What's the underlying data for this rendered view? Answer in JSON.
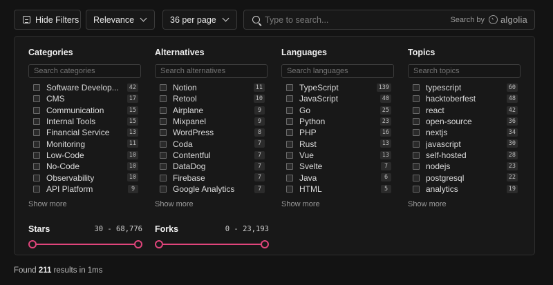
{
  "toolbar": {
    "hide_filters_label": "Hide Filters",
    "sort_value": "Relevance",
    "per_page_value": "36 per page",
    "search_placeholder": "Type to search...",
    "search_by_label": "Search by",
    "search_provider": "algolia"
  },
  "columns": [
    {
      "title": "Categories",
      "placeholder": "Search categories",
      "show_more": "Show more",
      "items": [
        {
          "label": "Software Develop...",
          "count": "42"
        },
        {
          "label": "CMS",
          "count": "17"
        },
        {
          "label": "Communication",
          "count": "15"
        },
        {
          "label": "Internal Tools",
          "count": "15"
        },
        {
          "label": "Financial Service",
          "count": "13"
        },
        {
          "label": "Monitoring",
          "count": "11"
        },
        {
          "label": "Low-Code",
          "count": "10"
        },
        {
          "label": "No-Code",
          "count": "10"
        },
        {
          "label": "Observability",
          "count": "10"
        },
        {
          "label": "API Platform",
          "count": "9"
        }
      ]
    },
    {
      "title": "Alternatives",
      "placeholder": "Search alternatives",
      "show_more": "Show more",
      "items": [
        {
          "label": "Notion",
          "count": "11"
        },
        {
          "label": "Retool",
          "count": "10"
        },
        {
          "label": "Airplane",
          "count": "9"
        },
        {
          "label": "Mixpanel",
          "count": "9"
        },
        {
          "label": "WordPress",
          "count": "8"
        },
        {
          "label": "Coda",
          "count": "7"
        },
        {
          "label": "Contentful",
          "count": "7"
        },
        {
          "label": "DataDog",
          "count": "7"
        },
        {
          "label": "Firebase",
          "count": "7"
        },
        {
          "label": "Google Analytics",
          "count": "7"
        }
      ]
    },
    {
      "title": "Languages",
      "placeholder": "Search languages",
      "show_more": "Show more",
      "items": [
        {
          "label": "TypeScript",
          "count": "139"
        },
        {
          "label": "JavaScript",
          "count": "40"
        },
        {
          "label": "Go",
          "count": "25"
        },
        {
          "label": "Python",
          "count": "23"
        },
        {
          "label": "PHP",
          "count": "16"
        },
        {
          "label": "Rust",
          "count": "13"
        },
        {
          "label": "Vue",
          "count": "13"
        },
        {
          "label": "Svelte",
          "count": "7"
        },
        {
          "label": "Java",
          "count": "6"
        },
        {
          "label": "HTML",
          "count": "5"
        }
      ]
    },
    {
      "title": "Topics",
      "placeholder": "Search topics",
      "show_more": "Show more",
      "items": [
        {
          "label": "typescript",
          "count": "60"
        },
        {
          "label": "hacktoberfest",
          "count": "48"
        },
        {
          "label": "react",
          "count": "42"
        },
        {
          "label": "open-source",
          "count": "36"
        },
        {
          "label": "nextjs",
          "count": "34"
        },
        {
          "label": "javascript",
          "count": "30"
        },
        {
          "label": "self-hosted",
          "count": "28"
        },
        {
          "label": "nodejs",
          "count": "23"
        },
        {
          "label": "postgresql",
          "count": "22"
        },
        {
          "label": "analytics",
          "count": "19"
        }
      ]
    }
  ],
  "ranges": [
    {
      "title": "Stars",
      "value": "30 - 68,776",
      "min": 30,
      "max": 68776,
      "low": 30,
      "high": 68776
    },
    {
      "title": "Forks",
      "value": "0 - 23,193",
      "min": 0,
      "max": 23193,
      "low": 0,
      "high": 23193
    }
  ],
  "footer": {
    "prefix": "Found",
    "count": "211",
    "suffix": "results in 1ms"
  },
  "colors": {
    "accent": "#e0457b",
    "background": "#131313",
    "panel": "#181818"
  }
}
